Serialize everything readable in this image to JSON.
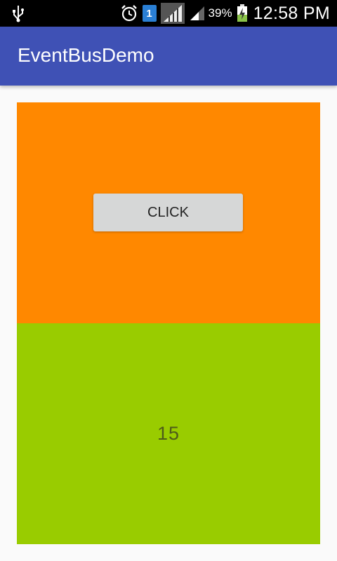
{
  "status_bar": {
    "battery_percent": "39%",
    "time": "12:58 PM",
    "sim_slot": "1",
    "icons": [
      "usb-icon",
      "alarm-icon",
      "sim-icon",
      "signal-full-icon",
      "signal-partial-icon",
      "battery-charging-icon"
    ]
  },
  "app_bar": {
    "title": "EventBusDemo",
    "color": "#3f51b5"
  },
  "top_panel": {
    "color": "#ff8800",
    "button_label": "CLICK",
    "button_color": "#d6d7d7"
  },
  "bottom_panel": {
    "color": "#99cc00",
    "counter_value": "15"
  }
}
